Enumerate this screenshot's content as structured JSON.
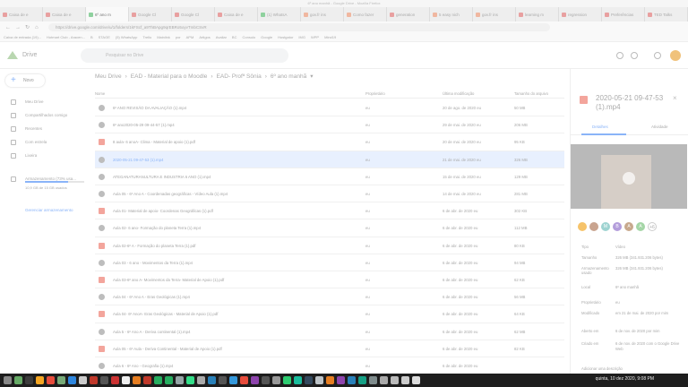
{
  "window_title": "6º ano manhã - Google Drive - Mozilla Firefox",
  "tabs": [
    {
      "label": "Caixa de e",
      "kind": "gmail"
    },
    {
      "label": "Caixa de e",
      "kind": "gmail"
    },
    {
      "label": "6º ano m",
      "kind": "drive",
      "active": true
    },
    {
      "label": "Google Cl",
      "kind": "gmail"
    },
    {
      "label": "Google Cl",
      "kind": "gmail"
    },
    {
      "label": "Caixa de e",
      "kind": "gmail"
    },
    {
      "label": "(1) WhatsA",
      "kind": "green"
    },
    {
      "label": "gov.fr ins",
      "kind": "yellow"
    },
    {
      "label": "Como fazer",
      "kind": "yellow"
    },
    {
      "label": "generation",
      "kind": "gmail"
    },
    {
      "label": "5 easy nich",
      "kind": "yellow"
    },
    {
      "label": "gov.fr ins",
      "kind": "yellow"
    },
    {
      "label": "learning m",
      "kind": "gmail"
    },
    {
      "label": "regression",
      "kind": "gmail"
    },
    {
      "label": "Preferências",
      "kind": "gmail"
    },
    {
      "label": "TED Talks",
      "kind": "gmail"
    }
  ],
  "url": "https://drive.google.com/drive/u/1/folders/1kFScf_a9ThBApg9qrEBRo5oyvTmbCSvR",
  "bookmarks": [
    "Caixa de entrada (19)...",
    "Hotmart Club - Aracen...",
    "B",
    "STAGE",
    "(5) WhatsApp",
    "Trello",
    "Mainlink",
    "por",
    "APM",
    "Artigos",
    "Avaliar",
    "BC",
    "Consulo",
    "Google",
    "Hostgator",
    "IMG",
    "WPP",
    "Mind19"
  ],
  "drive": {
    "logo_text": "Drive",
    "search_placeholder": "Pesquisar no Drive",
    "new_label": "Novo",
    "sidebar": [
      {
        "label": "Meu Drive"
      },
      {
        "label": "Compartilhados comigo"
      },
      {
        "label": "Recentes"
      },
      {
        "label": "Com estrela"
      },
      {
        "label": "Lixeira"
      },
      {
        "label": "Armazenamento (73% usa..."
      }
    ],
    "storage_text": "10,9 GB de 15 GB usados",
    "storage_fraction": 0.73,
    "manage_link": "Gerenciar armazenamento",
    "breadcrumb": [
      "Meu Drive",
      "EAD - Material para o Moodle",
      "EAD- Profª Sônia",
      "6º ano manhã"
    ],
    "columns": {
      "name": "Nome",
      "owner": "Proprietário",
      "modified": "Última modificação",
      "size": "Tamanho do arquivo"
    }
  },
  "files": [
    {
      "name": "6º ANO REVISÃO DA AVALIAÇÃO (1).mp4",
      "owner": "eu",
      "modified": "20 de ago. de 2020 eu",
      "size": "50 MB",
      "type": "video"
    },
    {
      "name": "6º ano2020-05-29 09-44-57 (1).mp4",
      "owner": "eu",
      "modified": "29 de mai. de 2020 eu",
      "size": "206 MB",
      "type": "video"
    },
    {
      "name": "8 aula- 6 anoA- Clima - Material de apoio (1).pdf",
      "owner": "eu",
      "modified": "20 de mai. de 2020 eu",
      "size": "95 KB",
      "type": "pdf"
    },
    {
      "name": "2020-05-21 09-47-53 (1).mp4",
      "owner": "eu",
      "modified": "21 de mai. de 2020 eu",
      "size": "326 MB",
      "type": "video",
      "selected": true
    },
    {
      "name": "ATEGANATURANULTURA E INDUSTRIA 6 ANO (1).mp4",
      "owner": "eu",
      "modified": "15 de mai. de 2020 eu",
      "size": "129 MB",
      "type": "video"
    },
    {
      "name": "Aula 05 - 6º Ano A - Coordenadas geográficas - Vídeo Aula (1).mp4",
      "owner": "eu",
      "modified": "14 de mai. de 2020 eu",
      "size": "281 MB",
      "type": "video"
    },
    {
      "name": "Aula 01- Material de apoio- Coordenas Geográficas (1).pdf",
      "owner": "eu",
      "modified": "6 de abr. de 2020 eu",
      "size": "302 KB",
      "type": "pdf"
    },
    {
      "name": "Aula 02- 6 ano- Formação do planeta Terra (1).mp4",
      "owner": "eu",
      "modified": "6 de abr. de 2020 eu",
      "size": "112 MB",
      "type": "video"
    },
    {
      "name": "Aula 02-6º A - Formação do planeta Terra (1).pdf",
      "owner": "eu",
      "modified": "6 de abr. de 2020 eu",
      "size": "80 KB",
      "type": "pdf"
    },
    {
      "name": "Aula 03 - 6 ano - Movimentos da Terra (1).mp4",
      "owner": "eu",
      "modified": "6 de abr. de 2020 eu",
      "size": "94 MB",
      "type": "video"
    },
    {
      "name": "Aula 03-6º ano A- Movimentos da Terra- Material de Apoio (1).pdf",
      "owner": "eu",
      "modified": "6 de abr. de 2020 eu",
      "size": "62 KB",
      "type": "pdf"
    },
    {
      "name": "Aula 04 - 6º Ano A - Eras Geológicas (1).mp4",
      "owner": "eu",
      "modified": "6 de abr. de 2020 eu",
      "size": "56 MB",
      "type": "video"
    },
    {
      "name": "Aula 04- 6º AnoA- Eras Geológicas - Material de Apoio (1).pdf",
      "owner": "eu",
      "modified": "6 de abr. de 2020 eu",
      "size": "64 KB",
      "type": "pdf"
    },
    {
      "name": "Aula 5 - 6º Ano A - Deriva continental (1).mp4",
      "owner": "eu",
      "modified": "6 de abr. de 2020 eu",
      "size": "62 MB",
      "type": "video"
    },
    {
      "name": "Aula 05 - 6º Aula - Deriva Continental - Material de Apoio (1).pdf",
      "owner": "eu",
      "modified": "6 de abr. de 2020 eu",
      "size": "82 KB",
      "type": "pdf"
    },
    {
      "name": "Aula 6 - 6º Ano - Geografia (1).mp4",
      "owner": "eu",
      "modified": "6 de abr. de 2020 eu",
      "size": "",
      "type": "video"
    }
  ],
  "details": {
    "title": "2020-05-21 09-47-53 (1).mp4",
    "tab_details": "Detalhes",
    "tab_activity": "Atividade",
    "avatars": [
      {
        "letter": "",
        "color": "#f6c36a"
      },
      {
        "letter": "",
        "color": "#c9a48f"
      },
      {
        "letter": "M",
        "color": "#9ed3d1"
      },
      {
        "letter": "B",
        "color": "#b39ddb"
      },
      {
        "letter": "A",
        "color": "#c7a98d"
      },
      {
        "letter": "A",
        "color": "#a5d6a7"
      },
      {
        "letter": "+6",
        "color": "#ffffff"
      }
    ],
    "fields": [
      {
        "label": "Tipo",
        "value": "Vídeo"
      },
      {
        "label": "Tamanho",
        "value": "326 MB (341.931.206 bytes)"
      },
      {
        "label": "Armazenamento usado",
        "value": "326 MB (341.931.206 bytes)"
      },
      {
        "label": "Local",
        "value": "6º ano manhã"
      },
      {
        "label": "Proprietário",
        "value": "eu"
      },
      {
        "label": "Modificado",
        "value": "em 21 de mai. de 2020 por mim"
      },
      {
        "label": "Aberto em",
        "value": "6 de nov. de 2020 por mim"
      },
      {
        "label": "Criado em",
        "value": "6 de nov. de 2020 com o Google Drive Web"
      }
    ],
    "add_description": "Adicionar uma descrição"
  },
  "taskbar_clock": "quinta, 10 dez 2020, 9:08 PM"
}
